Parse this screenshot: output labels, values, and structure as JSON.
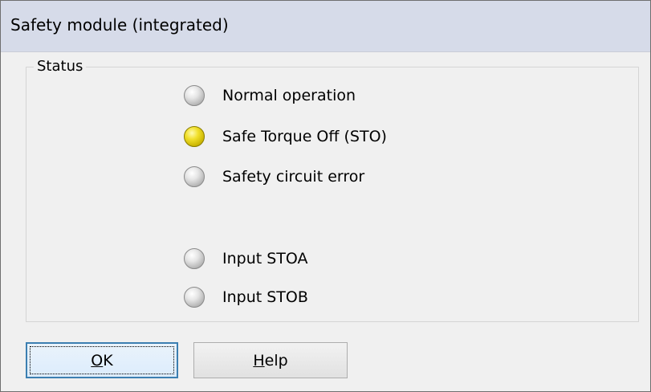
{
  "window": {
    "title": "Safety module (integrated)"
  },
  "group": {
    "label": "Status"
  },
  "status_items": [
    {
      "label": "Normal operation",
      "state": "off",
      "icon": "led-indicator"
    },
    {
      "label": "Safe Torque Off (STO)",
      "state": "on",
      "icon": "led-indicator",
      "color": "#e8d210"
    },
    {
      "label": "Safety circuit error",
      "state": "off",
      "icon": "led-indicator"
    },
    {
      "label": "Input STOA",
      "state": "off",
      "icon": "led-indicator"
    },
    {
      "label": "Input STOB",
      "state": "off",
      "icon": "led-indicator"
    }
  ],
  "buttons": {
    "ok": {
      "accesskey": "O",
      "rest": "K"
    },
    "help": {
      "accesskey": "H",
      "rest": "elp"
    }
  }
}
